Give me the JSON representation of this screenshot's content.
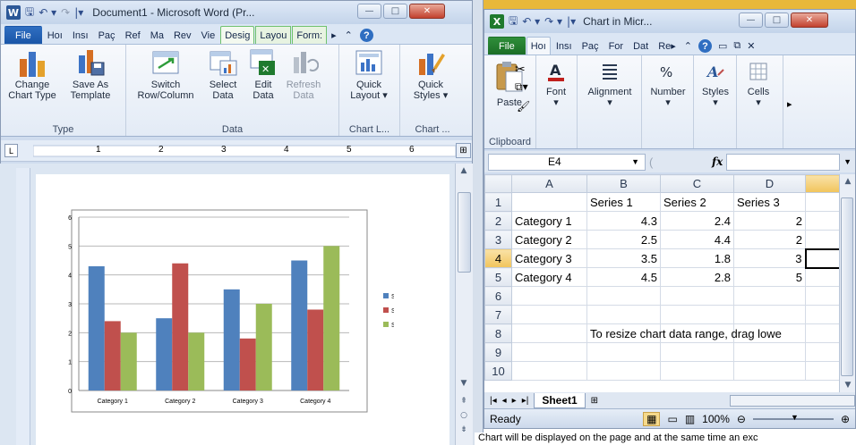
{
  "word": {
    "title": "Document1 - Microsoft Word (Pr...",
    "logo_letter": "W",
    "tabs": [
      "File",
      "Hoı",
      "Insı",
      "Paç",
      "Ref",
      "Ma",
      "Rev",
      "Vie",
      "Desig",
      "Layou",
      "Form:"
    ],
    "active_tab": "Desig",
    "ribbon": {
      "groups": [
        {
          "label": "Type",
          "buttons": [
            "Change Chart Type",
            "Save As Template"
          ]
        },
        {
          "label": "Data",
          "buttons": [
            "Switch Row/Column",
            "Select Data",
            "Edit Data",
            "Refresh Data"
          ]
        },
        {
          "label": "Chart L...",
          "buttons": [
            "Quick Layout ▾"
          ]
        },
        {
          "label": "Chart ...",
          "buttons": [
            "Quick Styles ▾"
          ]
        }
      ]
    },
    "ruler_marks": [
      "1",
      "2",
      "3",
      "4",
      "5",
      "6"
    ]
  },
  "chart_data": {
    "type": "bar",
    "categories": [
      "Category 1",
      "Category 2",
      "Category 3",
      "Category 4"
    ],
    "series": [
      {
        "name": "Series 1",
        "values": [
          4.3,
          2.5,
          3.5,
          4.5
        ],
        "color": "#4f81bd"
      },
      {
        "name": "Series 2",
        "values": [
          2.4,
          4.4,
          1.8,
          2.8
        ],
        "color": "#c0504d"
      },
      {
        "name": "Series 3",
        "values": [
          2,
          2,
          3,
          5
        ],
        "color": "#9bbb59"
      }
    ],
    "ylim": [
      0,
      6
    ],
    "yticks": [
      "0",
      "1",
      "2",
      "3",
      "4",
      "5",
      "6"
    ],
    "grid": true,
    "legend": "right"
  },
  "excel": {
    "title": "Chart in Micr...",
    "logo_letter": "X",
    "tabs": [
      "File",
      "Hoı",
      "Insı",
      "Paç",
      "For",
      "Dat",
      "Re▸"
    ],
    "ribbon_groups": [
      "Paste",
      "Font",
      "Alignment",
      "Number",
      "Styles",
      "Cells"
    ],
    "clipboard_label": "Clipboard",
    "name_box": "E4",
    "fx": "fx",
    "columns": [
      "A",
      "B",
      "C",
      "D"
    ],
    "rows": [
      {
        "n": "1",
        "cells": [
          "",
          "Series 1",
          "Series 2",
          "Series 3"
        ]
      },
      {
        "n": "2",
        "cells": [
          "Category 1",
          "4.3",
          "2.4",
          "2"
        ]
      },
      {
        "n": "3",
        "cells": [
          "Category 2",
          "2.5",
          "4.4",
          "2"
        ]
      },
      {
        "n": "4",
        "cells": [
          "Category 3",
          "3.5",
          "1.8",
          "3"
        ]
      },
      {
        "n": "5",
        "cells": [
          "Category 4",
          "4.5",
          "2.8",
          "5"
        ]
      },
      {
        "n": "6",
        "cells": [
          "",
          "",
          "",
          ""
        ]
      },
      {
        "n": "7",
        "cells": [
          "",
          "",
          "",
          ""
        ]
      },
      {
        "n": "8",
        "cells": [
          "",
          "To resize chart data range, drag lowe",
          "",
          ""
        ]
      },
      {
        "n": "9",
        "cells": [
          "",
          "",
          "",
          ""
        ]
      },
      {
        "n": "10",
        "cells": [
          "",
          "",
          "",
          ""
        ]
      }
    ],
    "sheet_tab": "Sheet1",
    "status": "Ready",
    "zoom": "100%"
  },
  "bottom_text": "Chart will be displayed on the page and at the same time an exc"
}
